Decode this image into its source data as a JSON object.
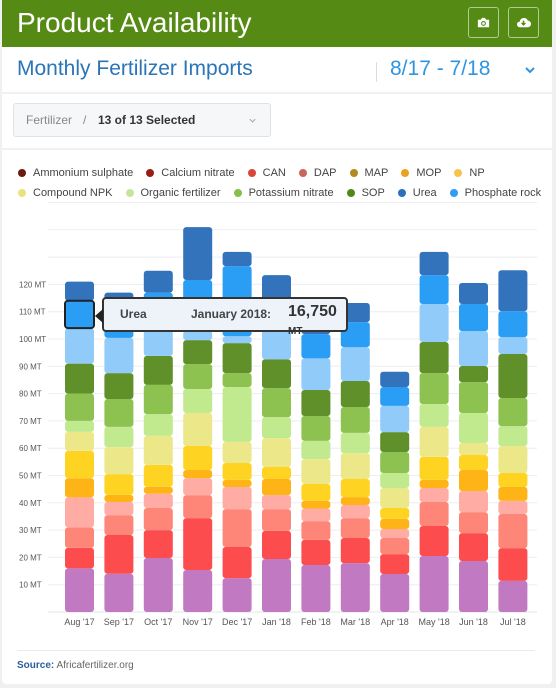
{
  "header": {
    "title": "Product Availability",
    "buttons": [
      {
        "name": "camera-icon",
        "label": "Screenshot"
      },
      {
        "name": "cloud-download-icon",
        "label": "Download"
      }
    ],
    "bg_color": "#558b15"
  },
  "subheader": {
    "title": "Monthly Fertilizer Imports",
    "date_range": "8/17 - 7/18"
  },
  "filter": {
    "label": "Fertilizer",
    "separator": "/",
    "value": "13 of 13 Selected"
  },
  "tooltip": {
    "series": "Urea",
    "date": "January 2018:",
    "value": "16,750",
    "unit": "MT"
  },
  "footer": {
    "source_label": "Source:",
    "source_value": "Africafertilizer.org"
  },
  "chart_data": {
    "type": "bar",
    "stacked": true,
    "title": "Monthly Fertilizer Imports",
    "xlabel": "",
    "ylabel": "",
    "ylim": [
      0,
      150
    ],
    "yticks": [
      10,
      20,
      30,
      40,
      50,
      60,
      70,
      80,
      90,
      100,
      110,
      120
    ],
    "ytick_labels": [
      "10 MT",
      "20 MT",
      "30 MT",
      "40 MT",
      "50 MT",
      "60 MT",
      "70 MT",
      "80 MT",
      "90 MT",
      "100 MT",
      "110 MT",
      "120 MT"
    ],
    "grid": true,
    "legend_position": "top",
    "categories": [
      "Aug '17",
      "Sep '17",
      "Oct '17",
      "Nov '17",
      "Dec '17",
      "Jan '18",
      "Feb '18",
      "Mar '18",
      "Apr '18",
      "May '18",
      "Jun '18",
      "Jul '18"
    ],
    "legend": [
      {
        "name": "Ammonium sulphate",
        "color": "#6b1a12"
      },
      {
        "name": "Calcium nitrate",
        "color": "#9b1c14"
      },
      {
        "name": "CAN",
        "color": "#d9453a"
      },
      {
        "name": "DAP",
        "color": "#c8675d"
      },
      {
        "name": "MAP",
        "color": "#b28a1e"
      },
      {
        "name": "MOP",
        "color": "#e9a21c"
      },
      {
        "name": "NP",
        "color": "#f7c34a"
      },
      {
        "name": "Compound NPK",
        "color": "#ebe27c"
      },
      {
        "name": "Organic fertilizer",
        "color": "#c4e69a"
      },
      {
        "name": "Potassium nitrate",
        "color": "#84c04a"
      },
      {
        "name": "SOP",
        "color": "#4e8a1a"
      },
      {
        "name": "Urea",
        "color": "#2a6fb8"
      },
      {
        "name": "Phosphate rock",
        "color": "#2e9ef2"
      }
    ],
    "series": [
      {
        "name": "Ammonium sulphate",
        "color": "#c17ac2",
        "values": [
          16,
          14,
          19.8,
          15.4,
          12.4,
          19.4,
          17.2,
          17.9,
          13.9,
          20.5,
          18.7,
          11.4
        ]
      },
      {
        "name": "Calcium nitrate",
        "color": "#fd4c4e",
        "values": [
          7.5,
          14.2,
          10.2,
          19,
          11.4,
          10.3,
          9.2,
          9.2,
          7.3,
          11,
          10.2,
          12
        ]
      },
      {
        "name": "CAN",
        "color": "#fe8678",
        "values": [
          7.5,
          7.3,
          8.1,
          8.4,
          13.9,
          8,
          6.9,
          7.3,
          5.9,
          8.8,
          7.7,
          12.5
        ]
      },
      {
        "name": "DAP",
        "color": "#feaca4",
        "values": [
          11,
          4.8,
          5.2,
          6.2,
          8.1,
          5.1,
          4.6,
          4.8,
          3.3,
          5.1,
          7.7,
          4.8
        ]
      },
      {
        "name": "MAP",
        "color": "#feb316",
        "values": [
          7,
          2.6,
          2.6,
          3,
          2.6,
          5.9,
          2.8,
          2.9,
          3.7,
          3,
          7.7,
          5.1
        ]
      },
      {
        "name": "MOP",
        "color": "#fed322",
        "values": [
          10,
          7.6,
          8,
          8.8,
          6.2,
          4.4,
          6.2,
          6.6,
          4,
          8.4,
          5.5,
          5.1
        ]
      },
      {
        "name": "NP",
        "color": "#ece88a",
        "values": [
          7,
          9.9,
          10.6,
          12.1,
          7.7,
          10.6,
          9.1,
          9.5,
          7.3,
          11,
          4.4,
          9.9
        ]
      },
      {
        "name": "Compound NPK",
        "color": "#c1e98d",
        "values": [
          4,
          7.4,
          8,
          8.8,
          20.1,
          7.7,
          6.7,
          7.4,
          5.5,
          8.4,
          11,
          7.3
        ]
      },
      {
        "name": "Organic fertilizer",
        "color": "#8dc150",
        "values": [
          10,
          10.2,
          10.7,
          9.1,
          5.1,
          10.6,
          9.1,
          9.5,
          7.7,
          11.3,
          11.3,
          10.3
        ]
      },
      {
        "name": "Potassium nitrate",
        "color": "#5f902a",
        "values": [
          11,
          9.5,
          10.6,
          8.8,
          11,
          10.6,
          9.5,
          9.5,
          7.3,
          11.4,
          5.9,
          16.1
        ]
      },
      {
        "name": "SOP",
        "color": "#90cbfa",
        "values": [
          13,
          12.9,
          11.2,
          3.4,
          2.5,
          10.7,
          11.6,
          12.4,
          9.6,
          13.9,
          12.8,
          6.2
        ]
      },
      {
        "name": "Urea",
        "color": "#2a9df4",
        "values": [
          10,
          9.6,
          12,
          18.6,
          25.7,
          10.7,
          8.9,
          9.2,
          6.9,
          10.6,
          9.9,
          9.5
        ]
      },
      {
        "name": "Phosphate rock",
        "color": "#3273bb",
        "values": [
          7,
          7,
          8,
          19.4,
          5.2,
          9.4,
          10.2,
          7,
          5.6,
          8.5,
          7.7,
          15
        ]
      }
    ],
    "highlighted": {
      "category": "Aug '17",
      "series": "Urea"
    },
    "annotations": [
      "Urea — January 2018: 16,750 MT"
    ]
  }
}
